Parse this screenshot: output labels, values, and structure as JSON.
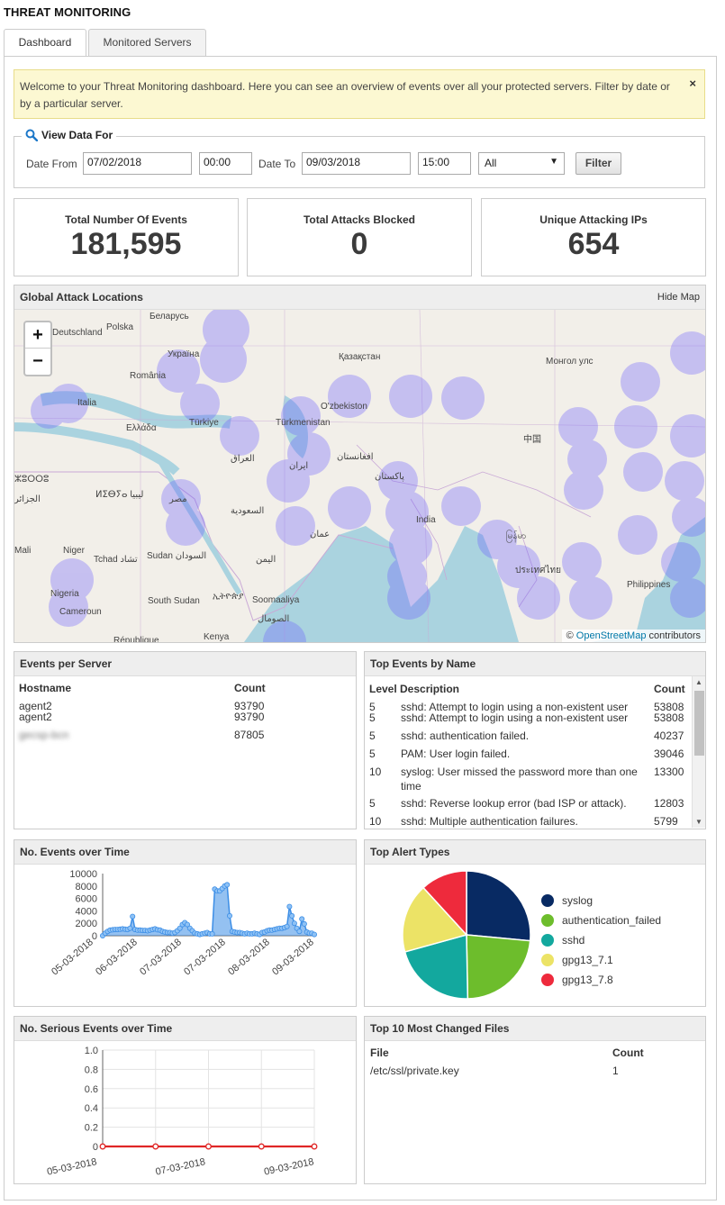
{
  "page": {
    "title": "THREAT MONITORING"
  },
  "tabs": [
    {
      "label": "Dashboard"
    },
    {
      "label": "Monitored Servers"
    }
  ],
  "notice": {
    "text": "Welcome to your Threat Monitoring dashboard. Here you can see an overview of events over all your protected servers. Filter by date or by a particular server.",
    "close": "×"
  },
  "filter": {
    "legend": "View Data For",
    "date_from_label": "Date From",
    "date_from": "07/02/2018",
    "time_from": "00:00",
    "date_to_label": "Date To",
    "date_to": "09/03/2018",
    "time_to": "15:00",
    "server_select": "All",
    "button": "Filter"
  },
  "stats": [
    {
      "label": "Total Number Of Events",
      "value": "181,595"
    },
    {
      "label": "Total Attacks Blocked",
      "value": "0"
    },
    {
      "label": "Unique Attacking IPs",
      "value": "654"
    }
  ],
  "map": {
    "title": "Global Attack Locations",
    "hide_label": "Hide Map",
    "zoom_in": "+",
    "zoom_out": "−",
    "attribution_prefix": "©",
    "attribution_link": "OpenStreetMap",
    "attribution_suffix": "contributors",
    "labels": [
      "Беларусь",
      "Polska",
      "Deutschland",
      "Україна",
      "România",
      "Italia",
      "Ελλάδα",
      "Türkiye",
      "Қазақстан",
      "Монгол улс",
      "O'zbekiston",
      "Türkmenistan",
      "中国",
      "العراق",
      "ایران",
      "افغانستان",
      "پاکستان",
      "ⵣⵓⵔⵔⵓ",
      "الجزائر",
      "ⵍⵉⴱⵢⴰ ليبيا",
      "مصر",
      "السعودية",
      "India",
      "Mali",
      "Niger",
      "Tchad تشاد",
      "Sudan السودان",
      "اليمن",
      "عمان",
      "ประเทศไทย",
      "Philippines",
      "Nigeria",
      "Cameroun",
      "South Sudan",
      "ኢትዮጵያ",
      "Soomaaliya",
      "الصومال",
      "République",
      "Kenya",
      "မြန်မာ"
    ]
  },
  "events_per_server": {
    "title": "Events per Server",
    "columns": [
      "Hostname",
      "Count"
    ],
    "rows": [
      {
        "host": "agent2",
        "count": "93790"
      },
      {
        "host": "agent2",
        "count": "93790"
      },
      {
        "host": "gecsp-bcn",
        "count": "87805"
      }
    ]
  },
  "top_events": {
    "title": "Top Events by Name",
    "columns": [
      "Level",
      "Description",
      "Count"
    ],
    "rows": [
      {
        "level": "5",
        "desc": "sshd: Attempt to login using a non-existent user",
        "count": "53808"
      },
      {
        "level": "5",
        "desc": "sshd: Attempt to login using a non-existent user",
        "count": "53808"
      },
      {
        "level": "5",
        "desc": "sshd: authentication failed.",
        "count": "40237"
      },
      {
        "level": "5",
        "desc": "PAM: User login failed.",
        "count": "39046"
      },
      {
        "level": "10",
        "desc": "syslog: User missed the password more than one time",
        "count": "13300"
      },
      {
        "level": "5",
        "desc": "sshd: Reverse lookup error (bad ISP or attack).",
        "count": "12803"
      },
      {
        "level": "10",
        "desc": "sshd: Multiple authentication failures.",
        "count": "5799"
      }
    ]
  },
  "events_over_time": {
    "title": "No. Events over Time"
  },
  "top_alert_types": {
    "title": "Top Alert Types",
    "legend": [
      {
        "name": "syslog",
        "color": "#082a63"
      },
      {
        "name": "authentication_failed",
        "color": "#6dbd2c"
      },
      {
        "name": "sshd",
        "color": "#13a89e"
      },
      {
        "name": "gpg13_7.1",
        "color": "#ece366"
      },
      {
        "name": "gpg13_7.8",
        "color": "#ee2a3c"
      }
    ]
  },
  "serious_events": {
    "title": "No. Serious Events over Time"
  },
  "changed_files": {
    "title": "Top 10 Most Changed Files",
    "columns": [
      "File",
      "Count"
    ],
    "rows": [
      {
        "file": "/etc/ssl/private.key",
        "count": "1"
      }
    ]
  },
  "chart_data": [
    {
      "type": "area",
      "title": "",
      "xlabel": "",
      "ylabel": "",
      "ylim": [
        0,
        10000
      ],
      "yticks": [
        0,
        2000,
        4000,
        6000,
        8000,
        10000
      ],
      "xtick_labels": [
        "05-03-2018",
        "06-03-2018",
        "07-03-2018",
        "07-03-2018",
        "08-03-2018",
        "09-03-2018"
      ],
      "grid": false,
      "color": "#3c8ee6",
      "series": [
        {
          "values": [
            0,
            400,
            700,
            900,
            950,
            1000,
            1000,
            1050,
            1100,
            1050,
            1000,
            1200,
            3100,
            1000,
            900,
            900,
            850,
            850,
            800,
            900,
            1000,
            1100,
            950,
            900,
            700,
            600,
            500,
            500,
            400,
            500,
            800,
            1200,
            1800,
            2100,
            1800,
            1200,
            800,
            400,
            300,
            200,
            300,
            400,
            500,
            300,
            300,
            7500,
            7200,
            7200,
            7600,
            8000,
            8200,
            3200,
            700,
            600,
            500,
            500,
            400,
            300,
            400,
            300,
            300,
            400,
            300,
            200,
            500,
            600,
            800,
            900,
            900,
            1000,
            1100,
            1200,
            1200,
            1300,
            1500,
            4700,
            3200,
            2000,
            1200,
            700,
            2700,
            1900,
            600,
            400,
            400,
            200
          ]
        }
      ]
    },
    {
      "type": "pie",
      "title": "",
      "legend_position": "right",
      "categories": [
        "syslog",
        "authentication_failed",
        "sshd",
        "gpg13_7.1",
        "gpg13_7.8"
      ],
      "values": [
        26.5,
        23.2,
        21.0,
        17.5,
        11.8
      ]
    },
    {
      "type": "line",
      "title": "",
      "xlabel": "",
      "ylabel": "",
      "ylim": [
        0,
        1.0
      ],
      "yticks": [
        0,
        0.2,
        0.4,
        0.6,
        0.8,
        1.0
      ],
      "xtick_labels": [
        "05-03-2018",
        "07-03-2018",
        "09-03-2018"
      ],
      "grid": true,
      "color": "#e02727",
      "series": [
        {
          "values": [
            0,
            0,
            0,
            0,
            0
          ]
        }
      ]
    }
  ]
}
